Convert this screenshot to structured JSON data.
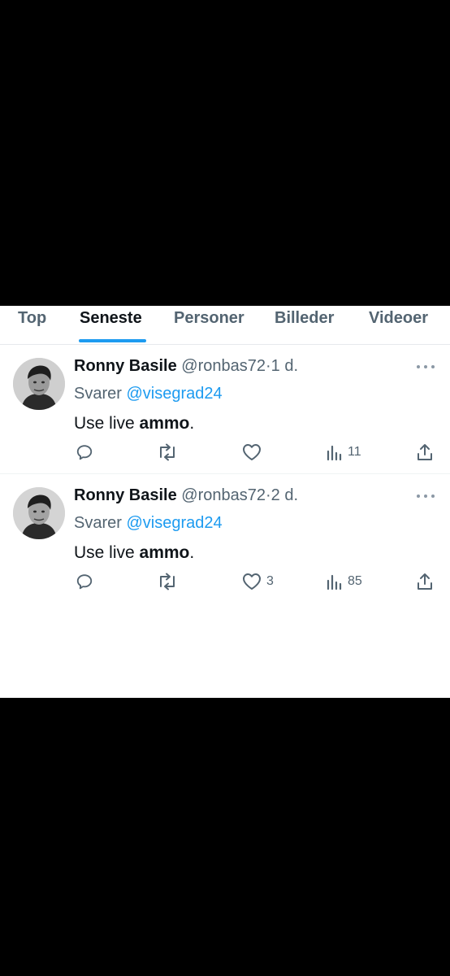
{
  "tabs": [
    {
      "label": "Top"
    },
    {
      "label": "Seneste",
      "active": true
    },
    {
      "label": "Personer"
    },
    {
      "label": "Billeder"
    },
    {
      "label": "Videoer"
    }
  ],
  "tweets": [
    {
      "name": "Ronny Basile",
      "handle": "@ronbas72",
      "dot": "·",
      "time": "1 d.",
      "reply_label": "Svarer",
      "reply_to": "@visegrad24",
      "text_plain": "Use live ",
      "text_bold": "ammo",
      "text_end": ".",
      "replies": "",
      "retweets": "",
      "likes": "",
      "views": "11"
    },
    {
      "name": "Ronny Basile",
      "handle": "@ronbas72",
      "dot": "·",
      "time": "2 d.",
      "reply_label": "Svarer",
      "reply_to": "@visegrad24",
      "text_plain": "Use live ",
      "text_bold": "ammo",
      "text_end": ".",
      "replies": "",
      "retweets": "",
      "likes": "3",
      "views": "85"
    }
  ],
  "colors": {
    "accent": "#1d9bf0",
    "text_primary": "#0f1419",
    "text_secondary": "#536471",
    "background_outer": "#000000",
    "background_panel": "#ffffff"
  },
  "icons": {
    "reply": "reply-icon",
    "retweet": "retweet-icon",
    "like": "heart-icon",
    "views": "views-icon",
    "share": "share-icon",
    "more": "more-icon"
  }
}
